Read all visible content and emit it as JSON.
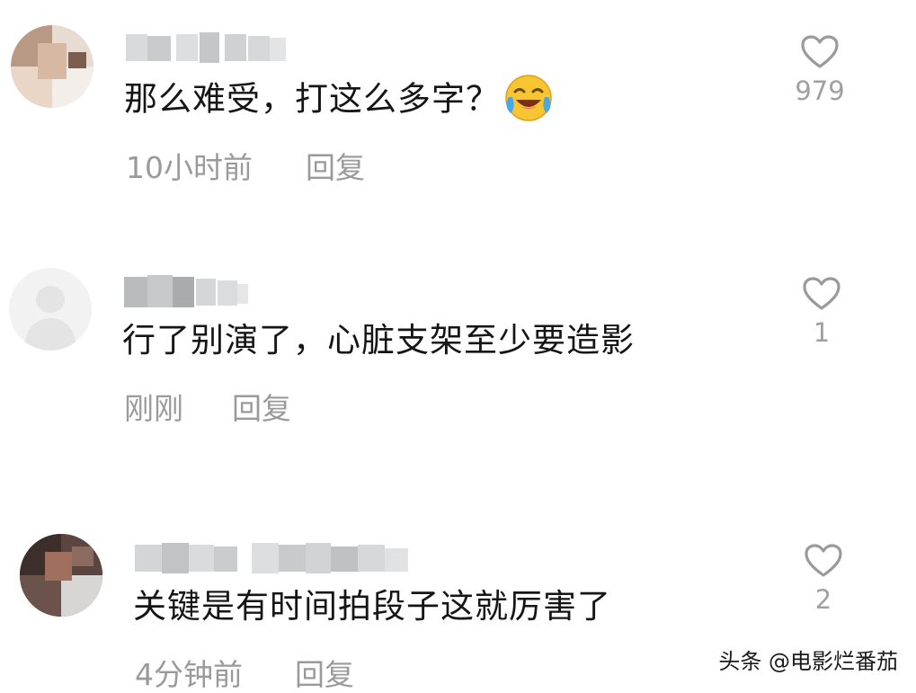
{
  "comments": [
    {
      "text": "那么难受，打这么多字？",
      "time": "10小时前",
      "reply_label": "回复",
      "like_count": "979",
      "emoji_icon": "laughing-crying-emoji-icon"
    },
    {
      "text": "行了别演了，心脏支架至少要造影",
      "time": "刚刚",
      "reply_label": "回复",
      "like_count": "1"
    },
    {
      "text": "关键是有时间拍段子这就厉害了",
      "time": "4分钟前",
      "reply_label": "回复",
      "like_count": "2"
    }
  ],
  "watermark": "头条 @电影烂番茄",
  "colors": {
    "text": "#151515",
    "meta": "#9a9a9a",
    "heart_outline": "#9a9a9a"
  }
}
